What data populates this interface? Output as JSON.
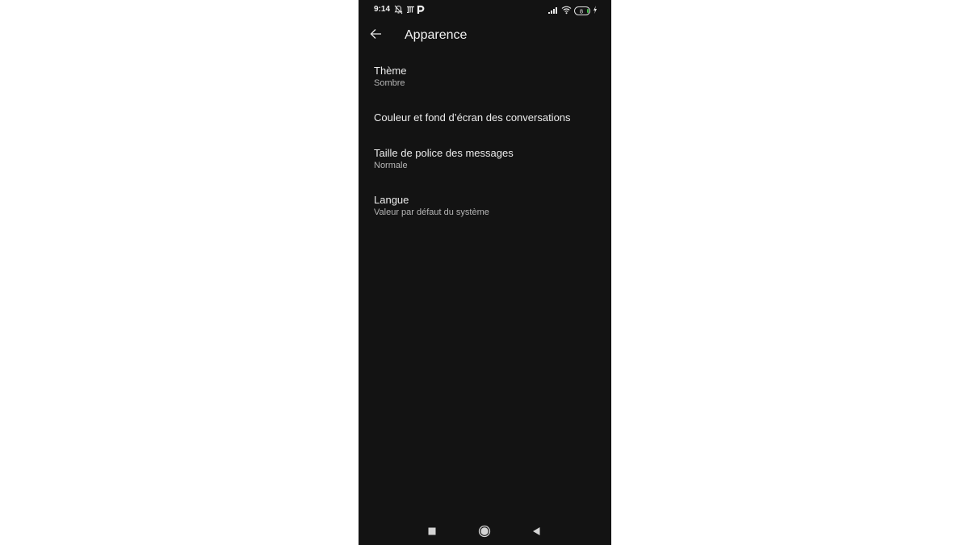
{
  "status_bar": {
    "time": "9:14",
    "left_icons": [
      "notifications-off-icon",
      "nfc-icon",
      "parking-app-icon"
    ],
    "right_icons": [
      "signal-icon",
      "wifi-icon",
      "battery-icon",
      "charging-icon"
    ],
    "battery_level": "8",
    "battery_color": "#3fc24a"
  },
  "toolbar": {
    "back_icon": "arrow-left-icon",
    "title": "Apparence"
  },
  "settings": [
    {
      "title": "Thème",
      "subtitle": "Sombre"
    },
    {
      "title": "Couleur et fond d’écran des conversations",
      "subtitle": null
    },
    {
      "title": "Taille de police des messages",
      "subtitle": "Normale"
    },
    {
      "title": "Langue",
      "subtitle": "Valeur par défaut du système"
    }
  ],
  "nav_bar": {
    "buttons": [
      "recents-square-icon",
      "home-circle-icon",
      "back-triangle-icon"
    ]
  }
}
